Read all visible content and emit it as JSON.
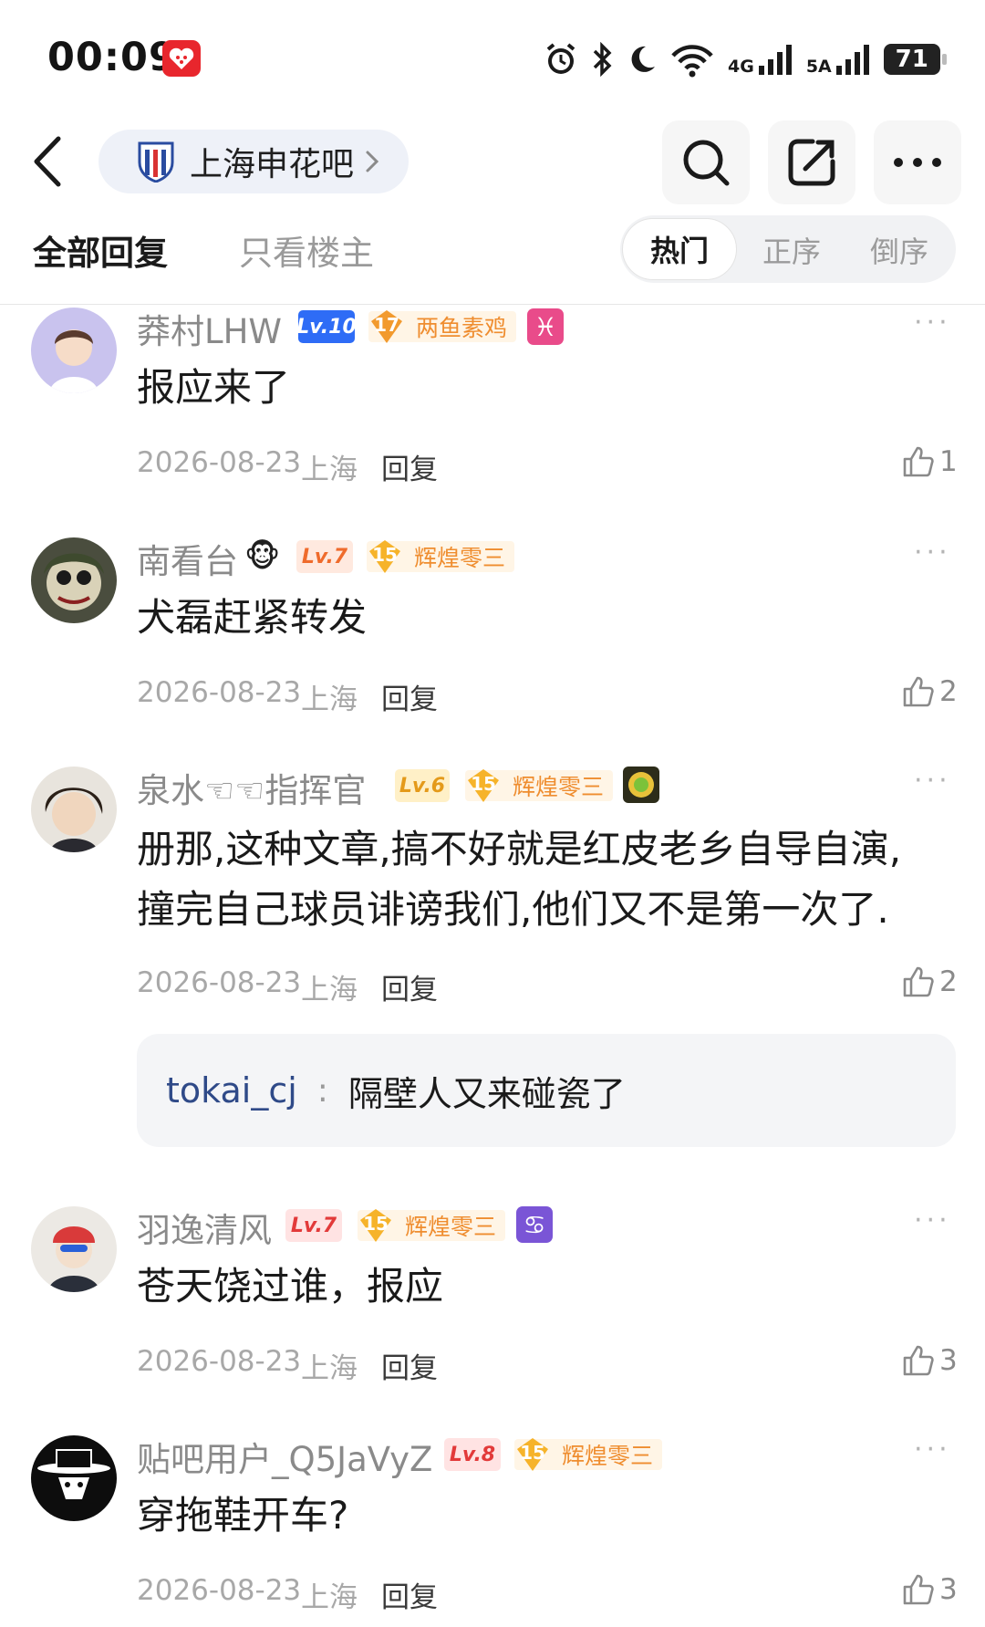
{
  "status_bar": {
    "time": "00:09",
    "net1": "4G",
    "net2": "5A",
    "battery": "71"
  },
  "nav": {
    "forum_name": "上海申花吧"
  },
  "filters": {
    "all_replies": "全部回复",
    "op_only": "只看楼主",
    "sort_hot": "热门",
    "sort_asc": "正序",
    "sort_desc": "倒序"
  },
  "comments": [
    {
      "username": "莽村LHW",
      "level": "Lv.10",
      "medal_level": "17",
      "medal_name": "两鱼素鸡",
      "text": "报应来了",
      "date": "2026-08-23",
      "location": "上海",
      "reply_label": "回复",
      "likes": "1"
    },
    {
      "username": "南看台",
      "level": "Lv.7",
      "medal_level": "15",
      "medal_name": "辉煌零三",
      "text": "犬磊赶紧转发",
      "date": "2026-08-23",
      "location": "上海",
      "reply_label": "回复",
      "likes": "2"
    },
    {
      "username": "泉水☜☜指挥官",
      "level": "Lv.6",
      "medal_level": "15",
      "medal_name": "辉煌零三",
      "text_line1": "册那,这种文章,搞不好就是红皮老乡自导自演,",
      "text_line2": "撞完自己球员诽谤我们,他们又不是第一次了.",
      "date": "2026-08-23",
      "location": "上海",
      "reply_label": "回复",
      "likes": "2",
      "sub_reply": {
        "user": "tokai_cj",
        "separator": ":",
        "text": "隔壁人又来碰瓷了"
      }
    },
    {
      "username": "羽逸清风",
      "level": "Lv.7",
      "medal_level": "15",
      "medal_name": "辉煌零三",
      "text": "苍天饶过谁，报应",
      "date": "2026-08-23",
      "location": "上海",
      "reply_label": "回复",
      "likes": "3"
    },
    {
      "username": "贴吧用户_Q5JaVyZ",
      "level": "Lv.8",
      "medal_level": "15",
      "medal_name": "辉煌零三",
      "text": "穿拖鞋开车?",
      "date": "2026-08-23",
      "location": "上海",
      "reply_label": "回复",
      "likes": "3"
    }
  ],
  "colors": {
    "accent_blue": "#2e6cf6",
    "medal_orange": "#ef8d2f",
    "subreply_user": "#2f4a88"
  },
  "icons": [
    "back-icon",
    "search-icon",
    "share-icon",
    "more-icon",
    "like-icon",
    "ellipsis-icon"
  ]
}
